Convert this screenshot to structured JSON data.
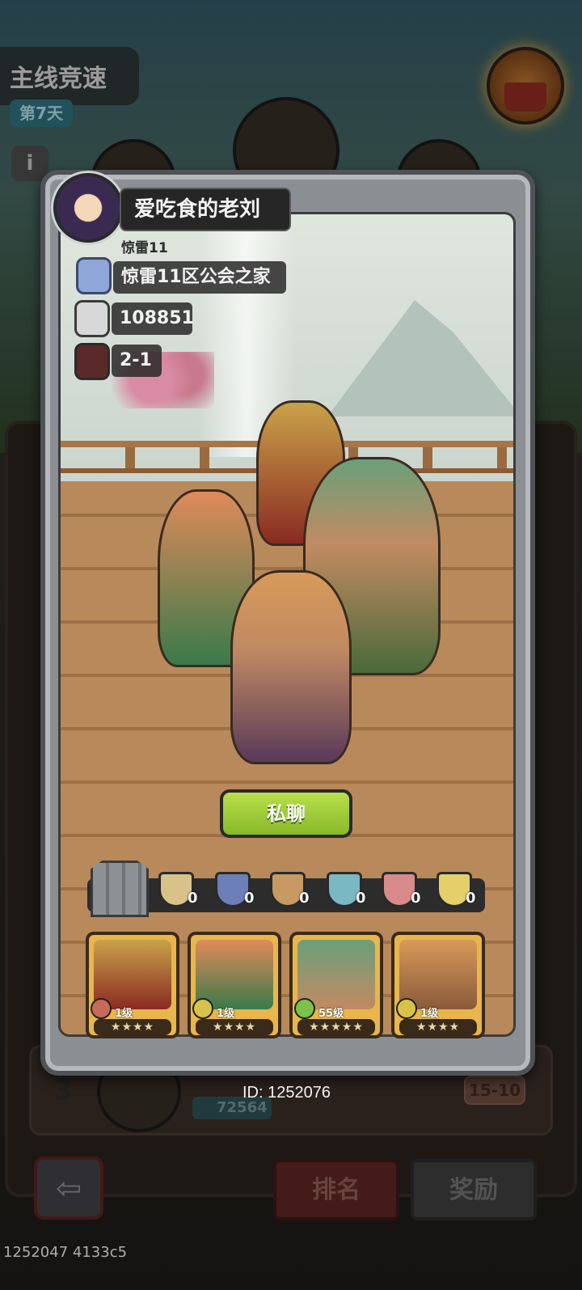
{
  "background": {
    "race_title": "主线竞速",
    "day_badge": "第7天",
    "info_button": "i",
    "rank_row": {
      "rank": "3",
      "power": "72564",
      "stage": "15-10"
    },
    "bottom_tabs": {
      "rank_label": "排名",
      "reward_label": "奖励"
    },
    "back_arrow": "⇦"
  },
  "player": {
    "name": "爱吃食的老刘",
    "server": "惊雷11",
    "guild": "惊雷11区公会之家",
    "power": "108851",
    "stage": "2-1",
    "id": "ID: 1252076"
  },
  "chat_button": "私聊",
  "factions": [
    {
      "icon": "sword-shield-icon",
      "count": "0",
      "color": "#d9c28a"
    },
    {
      "icon": "eye-shield-icon",
      "count": "0",
      "color": "#6d7fb8"
    },
    {
      "icon": "crystal-shield-icon",
      "count": "0",
      "color": "#c69a62"
    },
    {
      "icon": "swirl-shield-icon",
      "count": "0",
      "color": "#7ab8c4"
    },
    {
      "icon": "sun-shield-icon",
      "count": "0",
      "color": "#d98a8a"
    },
    {
      "icon": "flame-shield-icon",
      "count": "0",
      "color": "#e4cf6a"
    }
  ],
  "heroes": [
    {
      "name": "spartan-hero",
      "level": "1级",
      "stars": "★★★★",
      "element_color": "#c86a5a",
      "portrait_color": "#c9a24a"
    },
    {
      "name": "archer-girl-hero",
      "level": "1级",
      "stars": "★★★★",
      "element_color": "#d8c24a",
      "portrait_color": "#e08a5a"
    },
    {
      "name": "tribal-warrior-hero",
      "level": "55级",
      "stars": "★★★★★",
      "element_color": "#7ac24a",
      "portrait_color": "#6aa07a"
    },
    {
      "name": "stone-fist-hero",
      "level": "1级",
      "stars": "★★★★",
      "element_color": "#d8c24a",
      "portrait_color": "#d89a5a"
    }
  ],
  "debug_text": "1252047 4133c5"
}
